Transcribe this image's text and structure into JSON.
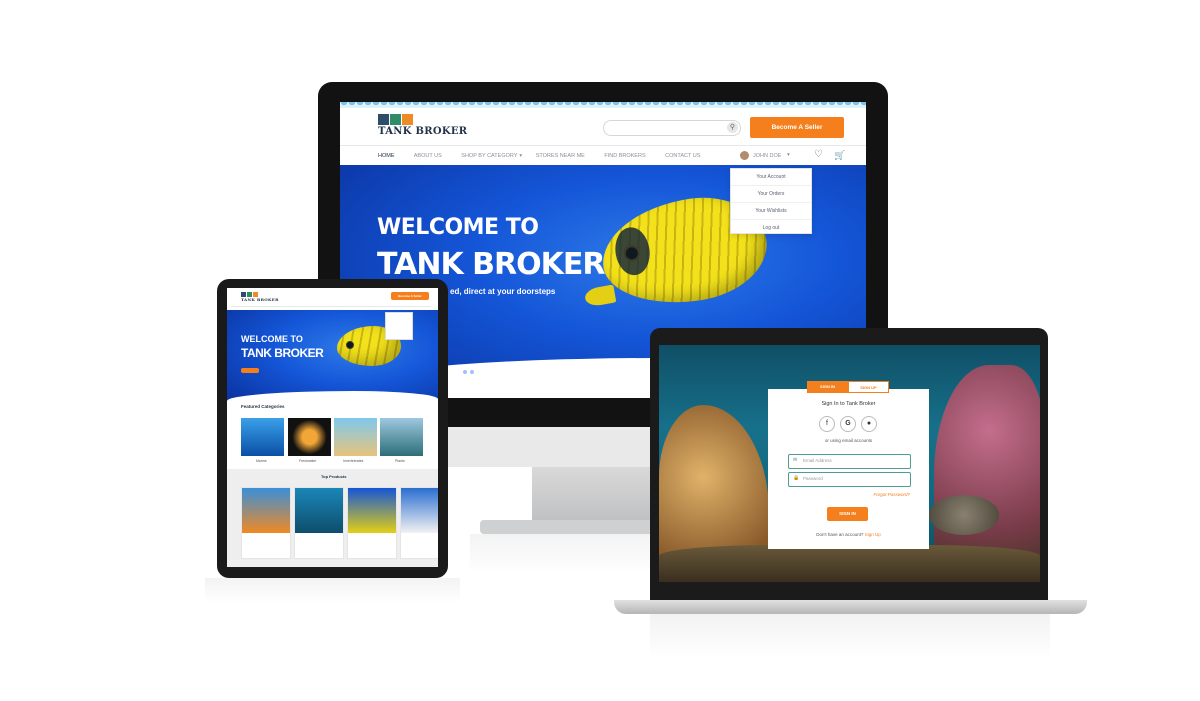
{
  "brand": {
    "name": "TANK BROKER"
  },
  "desktop": {
    "search_placeholder": "",
    "become_seller": "Become A Seller",
    "nav": [
      "HOME",
      "ABOUT US",
      "SHOP BY CATEGORY",
      "STORES NEAR ME",
      "FIND BROKERS",
      "CONTACT US"
    ],
    "user": "JOHN DOE",
    "user_menu": [
      "Your Account",
      "Your Orders",
      "Your Wishlists",
      "Log out"
    ],
    "hero_line1": "WELCOME TO",
    "hero_line2": "TANK BROKER",
    "hero_sub": "ed, direct at your doorsteps"
  },
  "tablet": {
    "become_seller": "Become A Seller",
    "hero_line1": "WELCOME TO",
    "hero_line2": "TANK BROKER",
    "featured_title": "Featured Categories",
    "categories": [
      "Marine",
      "Freshwater",
      "Invertebrates",
      "Plants"
    ],
    "top_products_title": "Top Products"
  },
  "laptop": {
    "tab_signin": "SIGN IN",
    "tab_signup": "SIGN UP",
    "title": "Sign In to Tank Broker",
    "or_text": "or using email accounts",
    "email_placeholder": "Email Address",
    "password_placeholder": "Password",
    "forgot": "Forgot Password?",
    "signin_btn": "SIGN IN",
    "no_account": "Don't have an account?",
    "signup_link": "Sign Up"
  },
  "colors": {
    "accent": "#f57f1c",
    "navy": "#23334a",
    "ocean": "#1456d8"
  }
}
